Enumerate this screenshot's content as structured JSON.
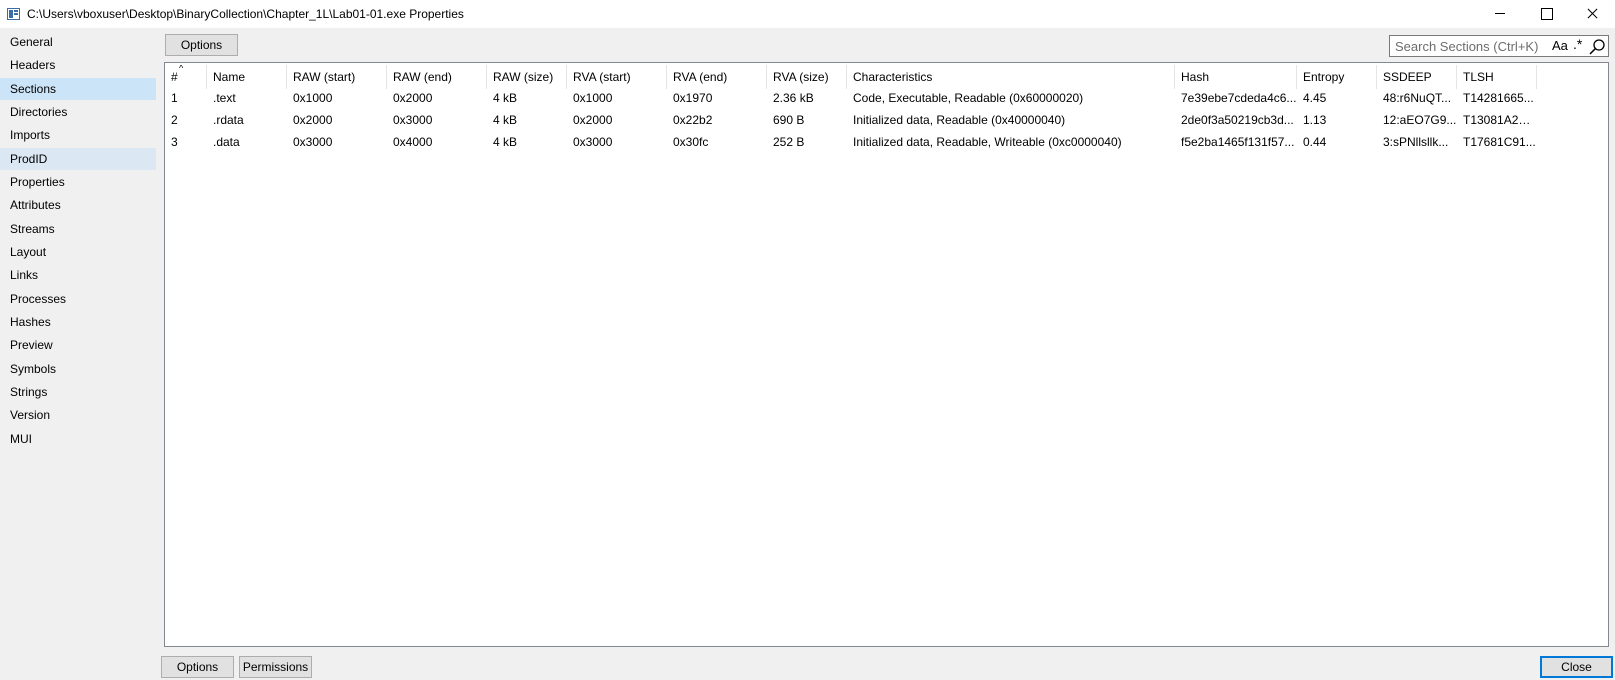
{
  "window": {
    "title": "C:\\Users\\vboxuser\\Desktop\\BinaryCollection\\Chapter_1L\\Lab01-01.exe Properties"
  },
  "sidebar": {
    "items": [
      {
        "label": "General"
      },
      {
        "label": "Headers"
      },
      {
        "label": "Sections"
      },
      {
        "label": "Directories"
      },
      {
        "label": "Imports"
      },
      {
        "label": "ProdID"
      },
      {
        "label": "Properties"
      },
      {
        "label": "Attributes"
      },
      {
        "label": "Streams"
      },
      {
        "label": "Layout"
      },
      {
        "label": "Links"
      },
      {
        "label": "Processes"
      },
      {
        "label": "Hashes"
      },
      {
        "label": "Preview"
      },
      {
        "label": "Symbols"
      },
      {
        "label": "Strings"
      },
      {
        "label": "Version"
      },
      {
        "label": "MUI"
      }
    ],
    "selected": "Sections",
    "highlighted": "ProdID"
  },
  "toolbar": {
    "options_label": "Options",
    "search_placeholder": "Search Sections (Ctrl+K)",
    "case_toggle": "Aa",
    "regex_toggle": ".*"
  },
  "table": {
    "headers": [
      "#",
      "Name",
      "RAW (start)",
      "RAW (end)",
      "RAW (size)",
      "RVA (start)",
      "RVA (end)",
      "RVA (size)",
      "Characteristics",
      "Hash",
      "Entropy",
      "SSDEEP",
      "TLSH"
    ],
    "sort_column": "#",
    "rows": [
      [
        "1",
        ".text",
        "0x1000",
        "0x2000",
        "4 kB",
        "0x1000",
        "0x1970",
        "2.36 kB",
        "Code, Executable, Readable (0x60000020)",
        "7e39ebe7cdeda4c6...",
        "4.45",
        "48:r6NuQT...",
        "T14281665..."
      ],
      [
        "2",
        ".rdata",
        "0x2000",
        "0x3000",
        "4 kB",
        "0x2000",
        "0x22b2",
        "690 B",
        "Initialized data, Readable (0x40000040)",
        "2de0f3a50219cb3d...",
        "1.13",
        "12:aEO7G9...",
        "T13081A2C..."
      ],
      [
        "3",
        ".data",
        "0x3000",
        "0x4000",
        "4 kB",
        "0x3000",
        "0x30fc",
        "252 B",
        "Initialized data, Readable, Writeable (0xc0000040)",
        "f5e2ba1465f131f57...",
        "0.44",
        "3:sPNllsllk...",
        "T17681C91..."
      ]
    ]
  },
  "footer": {
    "options_label": "Options",
    "permissions_label": "Permissions",
    "close_label": "Close"
  },
  "colors": {
    "selected_nav": "#cce4f7",
    "accent": "#0078d7"
  }
}
